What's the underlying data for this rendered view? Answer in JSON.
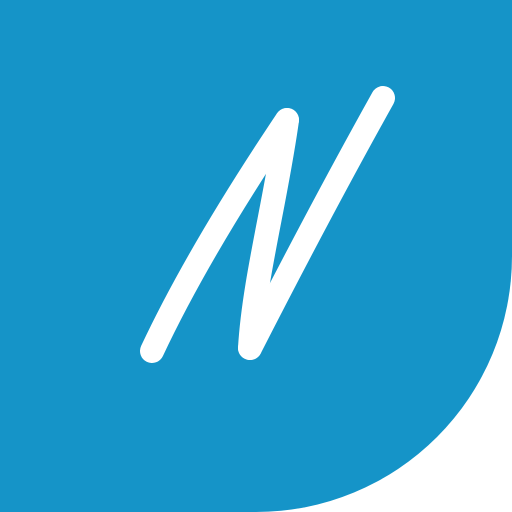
{
  "icon": {
    "name": "n-script-logo-icon",
    "letter": "N",
    "background_color": "#1594C8",
    "glyph_color": "#FFFFFF"
  }
}
